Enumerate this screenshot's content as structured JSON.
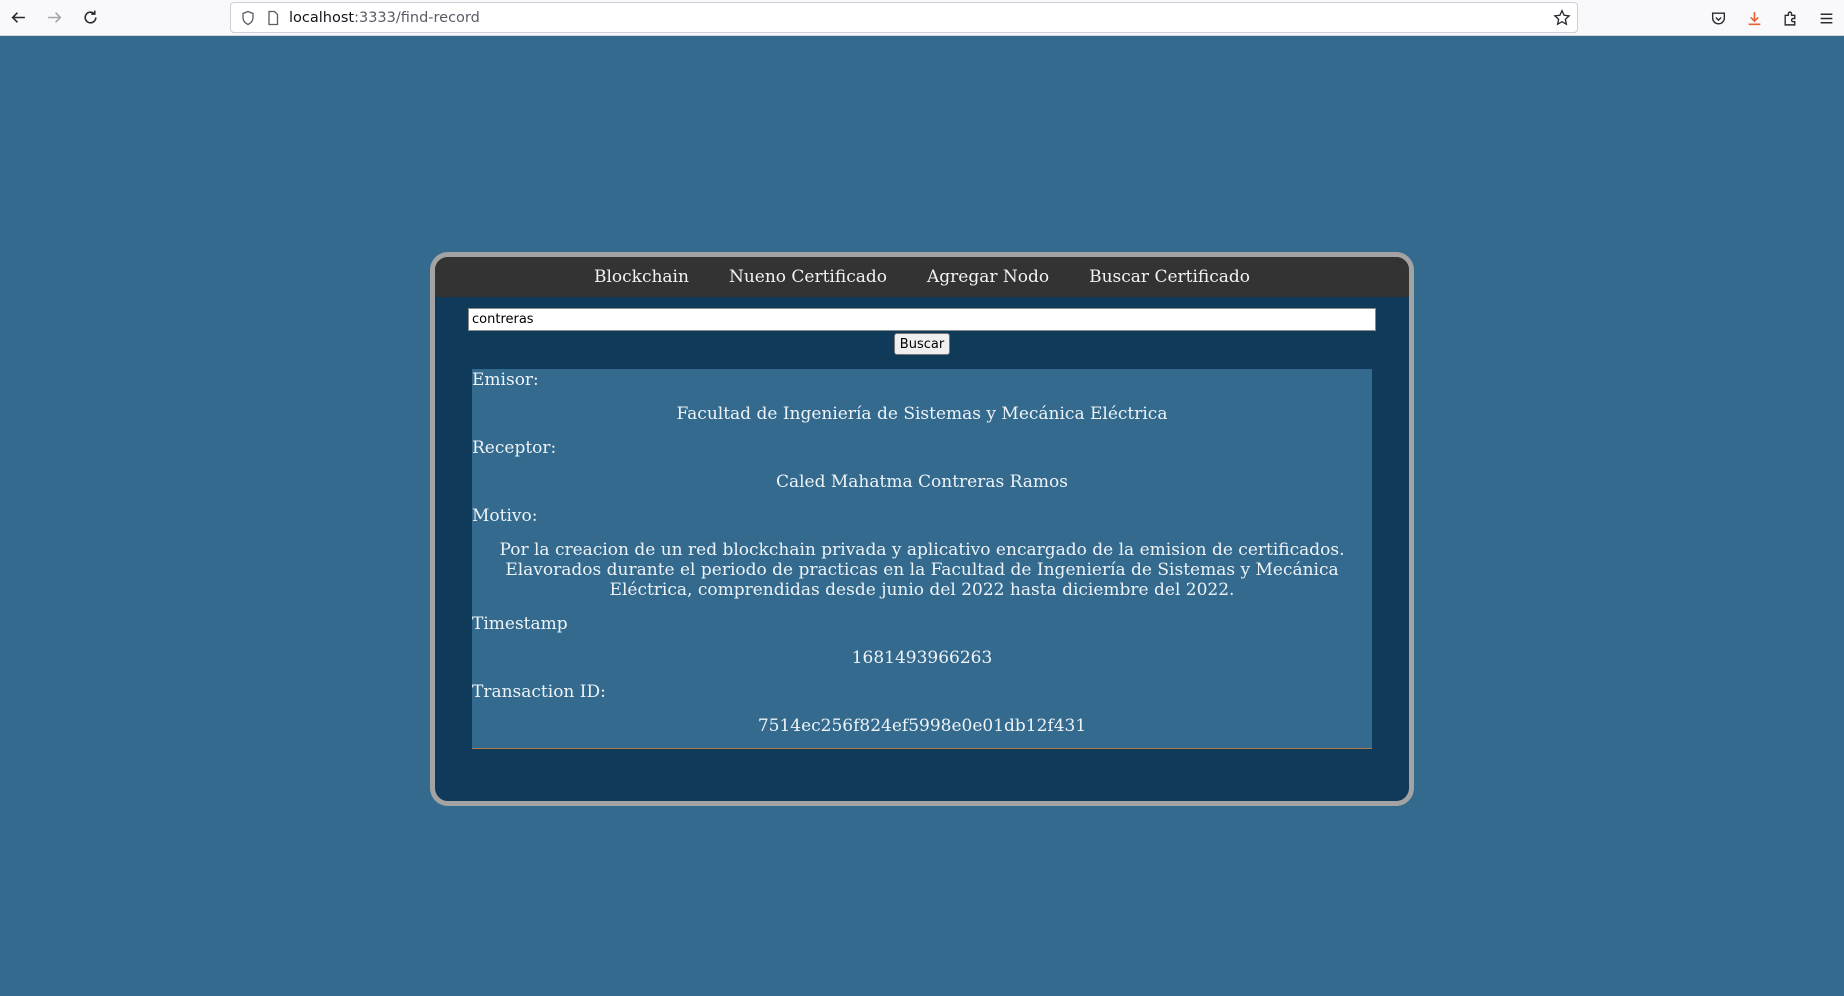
{
  "browser": {
    "url_host": "localhost",
    "url_rest": ":3333/find-record"
  },
  "menu": {
    "items": [
      "Blockchain",
      "Nueno Certificado",
      "Agregar Nodo",
      "Buscar Certificado"
    ]
  },
  "search": {
    "value": "contreras",
    "button_label": "Buscar"
  },
  "record": {
    "emisor_label": "Emisor:",
    "emisor_value": "Facultad de Ingeniería de Sistemas y Mecánica Eléctrica",
    "receptor_label": "Receptor:",
    "receptor_value": "Caled Mahatma Contreras Ramos",
    "motivo_label": "Motivo:",
    "motivo_value": "Por la creacion de un red blockchain privada y aplicativo encargado de la emision de certificados. Elavorados durante el periodo de practicas en la Facultad de Ingeniería de Sistemas y Mecánica Eléctrica, comprendidas desde junio del 2022 hasta diciembre del 2022.",
    "timestamp_label": "Timestamp",
    "timestamp_value": "1681493966263",
    "txid_label": "Transaction ID:",
    "txid_value": "7514ec256f824ef5998e0e01db12f431"
  }
}
